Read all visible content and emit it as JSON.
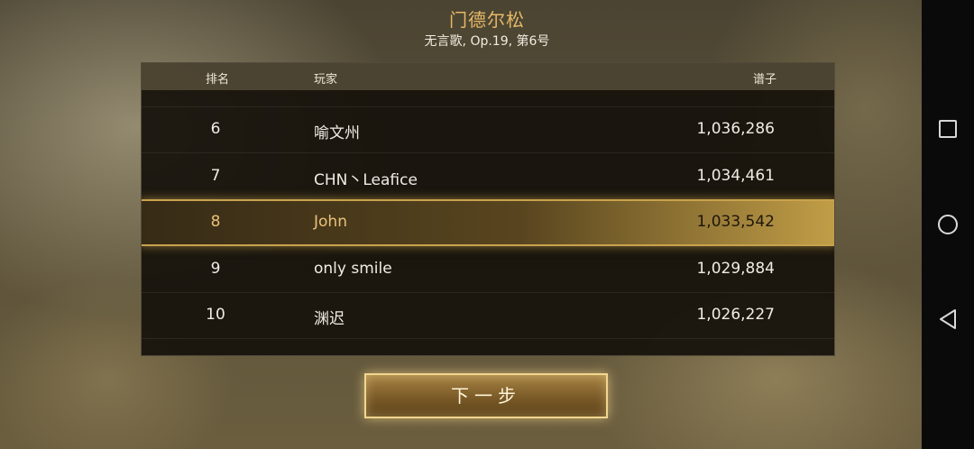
{
  "header": {
    "title": "门德尔松",
    "subtitle": "无言歌, Op.19, 第6号"
  },
  "leaderboard": {
    "columns": {
      "rank": "排名",
      "player": "玩家",
      "score": "谱子"
    },
    "rows": [
      {
        "rank": "6",
        "player": "喻文州",
        "score": "1,036,286"
      },
      {
        "rank": "7",
        "player": "CHN丶Leafice",
        "score": "1,034,461"
      },
      {
        "rank": "8",
        "player": "John",
        "score": "1,033,542",
        "highlighted": true
      },
      {
        "rank": "9",
        "player": "only smile",
        "score": "1,029,884"
      },
      {
        "rank": "10",
        "player": "渊迟",
        "score": "1,026,227"
      }
    ]
  },
  "next_button": {
    "label": "下一步"
  },
  "system_nav": {
    "icons": [
      "recent-apps-square-icon",
      "home-circle-icon",
      "back-triangle-icon"
    ]
  },
  "colors": {
    "title_gold": "#e6b866",
    "highlight_border": "#c9a24d",
    "highlight_text": "#e9c27a",
    "button_border": "#f1d68f"
  }
}
